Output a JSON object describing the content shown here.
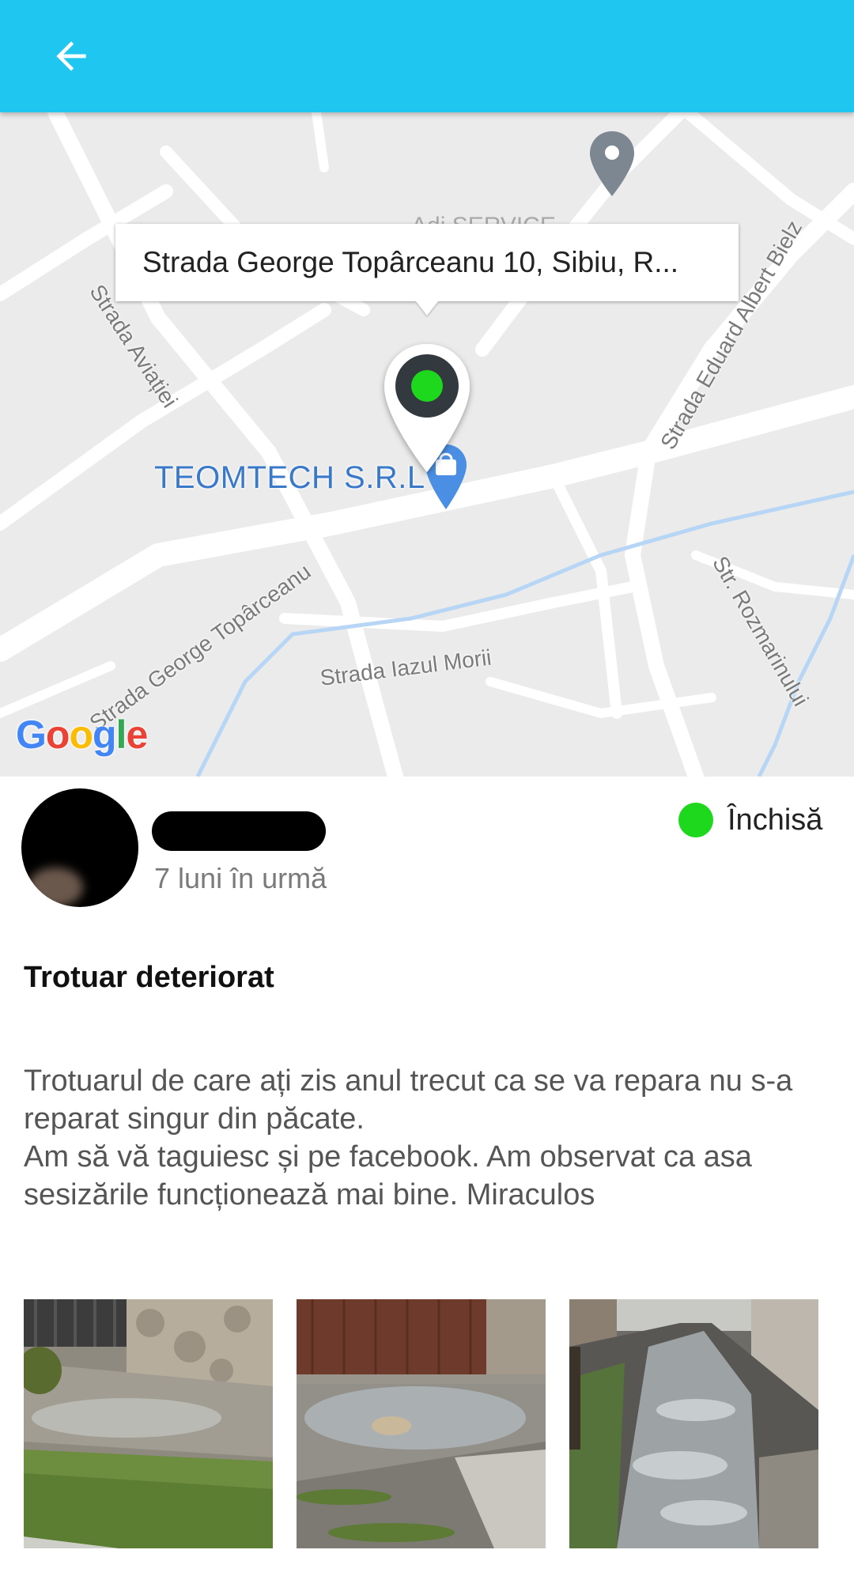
{
  "appbar": {
    "back_icon": "arrow-left-icon",
    "color": "#1ec6f0"
  },
  "map": {
    "info_window_text": "Strada George Topârceanu 10, Sibiu, R...",
    "poi_label": "TEOMTECH S.R.L",
    "poi_faded_label": "Adi SERVICE",
    "streets": {
      "aviatiei": "Strada Aviației",
      "bielz": "Strada Eduard Albert Bielz",
      "toparceanu": "Strada George Topârceanu",
      "iazul": "Strada Iazul Morii",
      "rozmarinului": "Str. Rozmarinului"
    },
    "pin_status_color": "#1ed81e",
    "attribution": "Google"
  },
  "report": {
    "time_ago": "7 luni în urmă",
    "status_label": "Închisă",
    "status_color": "#1ed81e",
    "title": "Trotuar deteriorat",
    "description": "Trotuarul de care ați zis anul trecut ca se va repara nu s-a reparat singur din păcate.\nAm să vă taguiesc și pe facebook. Am observat ca asa sesizările funcționează mai bine. Miraculos"
  },
  "photos": [
    "sidewalk-puddle-photo",
    "gate-puddle-photo",
    "street-puddles-photo"
  ]
}
